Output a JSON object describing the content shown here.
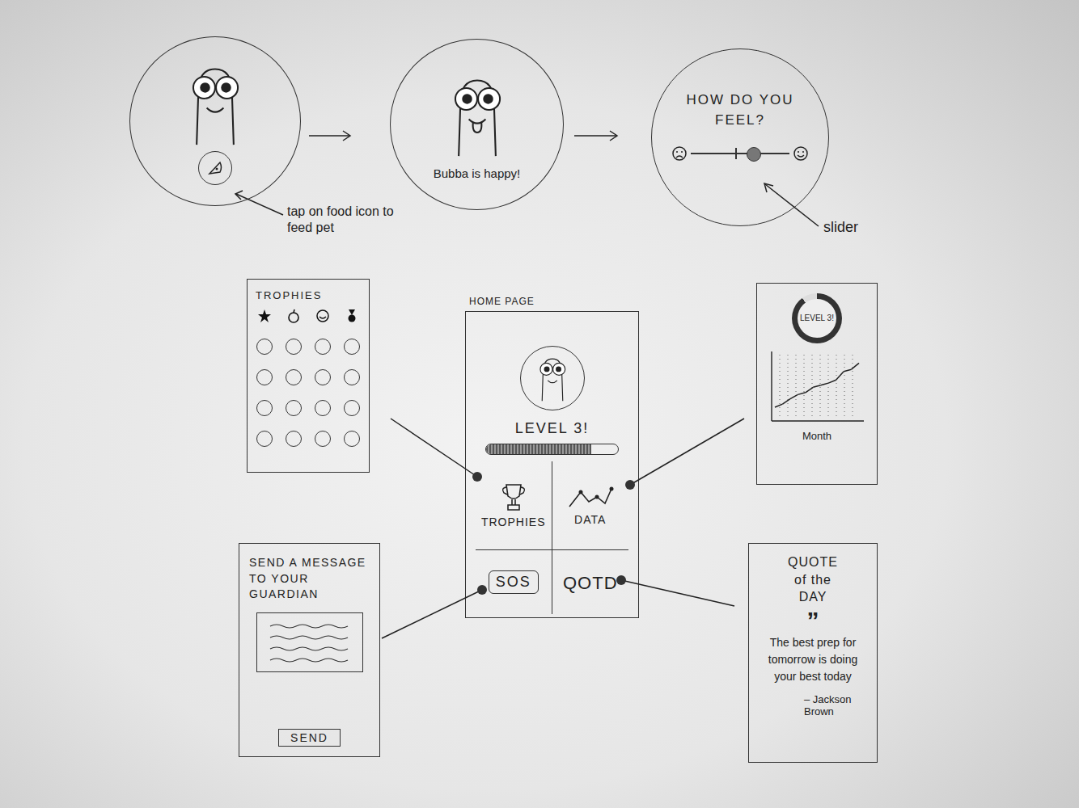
{
  "flow": {
    "feed": {
      "annotation": "tap on food icon to feed pet"
    },
    "happy": {
      "caption": "Bubba is happy!"
    },
    "mood": {
      "title": "HOW DO YOU FEEL?",
      "level": 0.63,
      "annotation": "slider"
    }
  },
  "home": {
    "label": "HOME PAGE",
    "level_text": "LEVEL 3!",
    "progress": {
      "level": 0.8
    },
    "tiles": [
      {
        "label": "TROPHIES",
        "kind": "trophy"
      },
      {
        "label": "DATA",
        "kind": "data"
      },
      {
        "label": "SOS",
        "kind": "sos"
      },
      {
        "label": "QOTD",
        "kind": "qotd"
      }
    ]
  },
  "trophies": {
    "title": "TROPHIES",
    "badges": [
      {
        "kind": "star",
        "earned": true
      },
      {
        "kind": "apple",
        "earned": true
      },
      {
        "kind": "smiley",
        "earned": true
      },
      {
        "kind": "medal",
        "earned": true
      },
      {
        "kind": "empty",
        "earned": false
      },
      {
        "kind": "empty",
        "earned": false
      },
      {
        "kind": "empty",
        "earned": false
      },
      {
        "kind": "empty",
        "earned": false
      },
      {
        "kind": "empty",
        "earned": false
      },
      {
        "kind": "empty",
        "earned": false
      },
      {
        "kind": "empty",
        "earned": false
      },
      {
        "kind": "empty",
        "earned": false
      },
      {
        "kind": "empty",
        "earned": false
      },
      {
        "kind": "empty",
        "earned": false
      },
      {
        "kind": "empty",
        "earned": false
      },
      {
        "kind": "empty",
        "earned": false
      },
      {
        "kind": "empty",
        "earned": false
      },
      {
        "kind": "empty",
        "earned": false
      },
      {
        "kind": "empty",
        "earned": false
      },
      {
        "kind": "empty",
        "earned": false
      }
    ]
  },
  "data": {
    "level_text": "LEVEL 3!",
    "ring_level": 0.9,
    "chart": {
      "values": [
        1,
        1.3,
        1.8,
        2.2,
        2.4,
        2.9,
        3.1,
        3.3,
        3.6,
        4.4,
        4.6,
        5.2
      ],
      "x_label": "Month"
    }
  },
  "sos": {
    "title": "SEND A MESSAGE TO YOUR GUARDIAN",
    "button": "SEND"
  },
  "quote": {
    "title": "QUOTE of the DAY",
    "mark": "”",
    "text": "The best prep for tomorrow is doing your best today",
    "author": "– Jackson Brown"
  }
}
